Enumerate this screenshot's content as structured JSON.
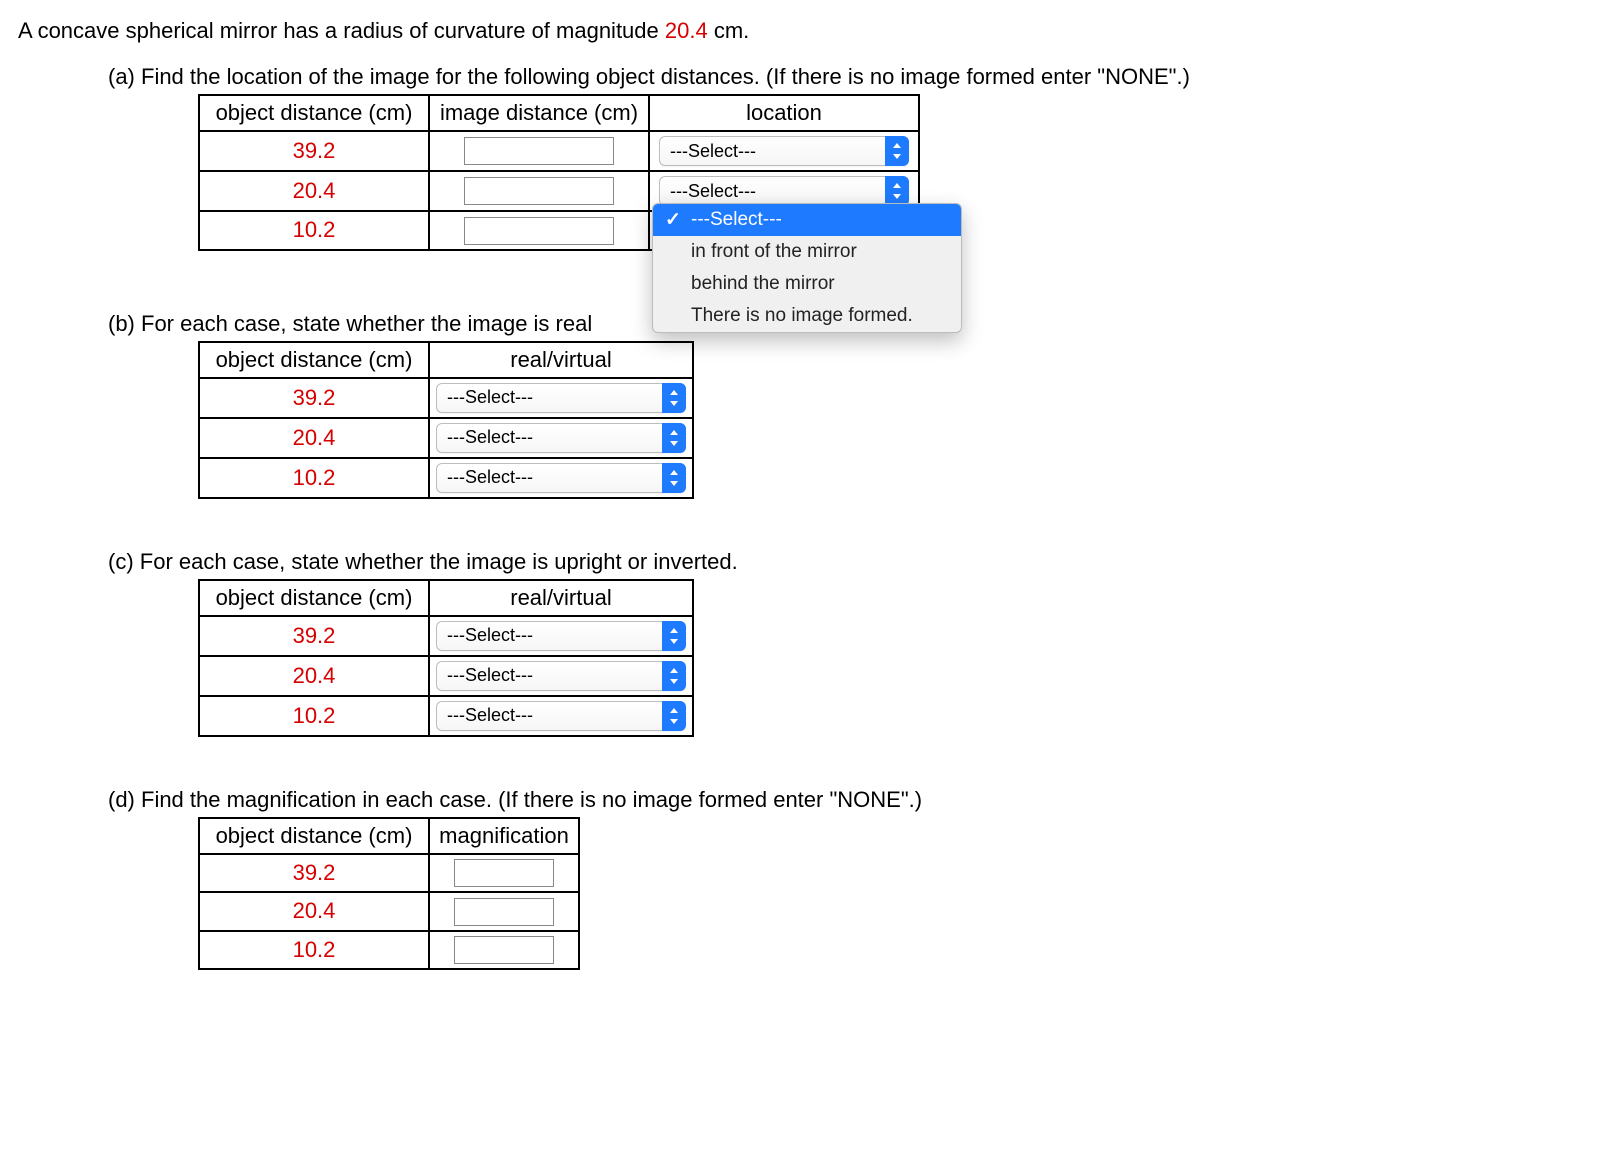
{
  "intro": {
    "prefix": "A concave spherical mirror has a radius of curvature of magnitude ",
    "value": "20.4",
    "suffix": " cm."
  },
  "partA": {
    "prompt": "(a) Find the location of the image for the following object distances. (If there is no image formed enter \"NONE\".)",
    "headers": {
      "obj": "object distance (cm)",
      "img": "image distance (cm)",
      "loc": "location"
    },
    "rows": [
      {
        "obj": "39.2",
        "img": "",
        "loc": "---Select---"
      },
      {
        "obj": "20.4",
        "img": "",
        "loc": "---Select---"
      },
      {
        "obj": "10.2",
        "img": "",
        "loc": "---Select---"
      }
    ],
    "dropdown": {
      "selected_index": 0,
      "options": [
        "---Select---",
        "in front of the mirror",
        "behind the mirror",
        "There is no image formed."
      ]
    }
  },
  "partB": {
    "prompt": "(b) For each case, state whether the image is real",
    "headers": {
      "obj": "object distance (cm)",
      "rv": "real/virtual"
    },
    "rows": [
      {
        "obj": "39.2",
        "rv": "---Select---"
      },
      {
        "obj": "20.4",
        "rv": "---Select---"
      },
      {
        "obj": "10.2",
        "rv": "---Select---"
      }
    ]
  },
  "partC": {
    "prompt": "(c) For each case, state whether the image is upright or inverted.",
    "headers": {
      "obj": "object distance (cm)",
      "rv": "real/virtual"
    },
    "rows": [
      {
        "obj": "39.2",
        "rv": "---Select---"
      },
      {
        "obj": "20.4",
        "rv": "---Select---"
      },
      {
        "obj": "10.2",
        "rv": "---Select---"
      }
    ]
  },
  "partD": {
    "prompt": "(d) Find the magnification in each case. (If there is no image formed enter \"NONE\".)",
    "headers": {
      "obj": "object distance (cm)",
      "mag": "magnification"
    },
    "rows": [
      {
        "obj": "39.2",
        "mag": ""
      },
      {
        "obj": "20.4",
        "mag": ""
      },
      {
        "obj": "10.2",
        "mag": ""
      }
    ]
  }
}
